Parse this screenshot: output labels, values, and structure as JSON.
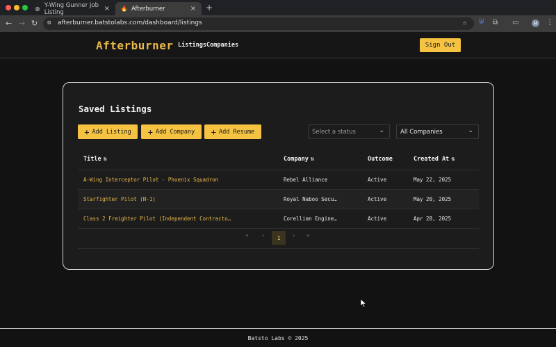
{
  "browser": {
    "tabs": [
      {
        "title": "Y-Wing Gunner Job Listing",
        "active": false
      },
      {
        "title": "Afterburner",
        "active": true
      }
    ],
    "url": "afterburner.batstolabs.com/dashboard/listings",
    "profile_initial": "M"
  },
  "header": {
    "logo": "Afterburner",
    "nav": [
      "Listings",
      "Companies"
    ],
    "sign_out": "Sign Out"
  },
  "listings": {
    "title": "Saved Listings",
    "buttons": [
      "Add Listing",
      "Add Company",
      "Add Resume"
    ],
    "status_filter": {
      "placeholder": "Select a status"
    },
    "company_filter": {
      "value": "All Companies"
    },
    "columns": [
      "Title",
      "Company",
      "Outcome",
      "Created At"
    ],
    "rows": [
      {
        "title": "A-Wing Interceptor Pilot - Phoenix Squadron",
        "company": "Rebel Alliance",
        "outcome": "Active",
        "created": "May 22, 2025"
      },
      {
        "title": "Starfighter Pilot (N-1)",
        "company": "Royal Naboo Secu…",
        "outcome": "Active",
        "created": "May 20, 2025"
      },
      {
        "title": "Class 2 Freighter Pilot (Independent Contracto…",
        "company": "Corellian Engine…",
        "outcome": "Active",
        "created": "Apr 28, 2025"
      }
    ],
    "pagination": {
      "first": "«",
      "prev": "‹",
      "current": "1",
      "next": "›",
      "last": "»"
    }
  },
  "footer": {
    "text": "Batsto Labs © 2025"
  },
  "colors": {
    "accent": "#f5c242",
    "link": "#e8b84a",
    "background": "#121212"
  }
}
